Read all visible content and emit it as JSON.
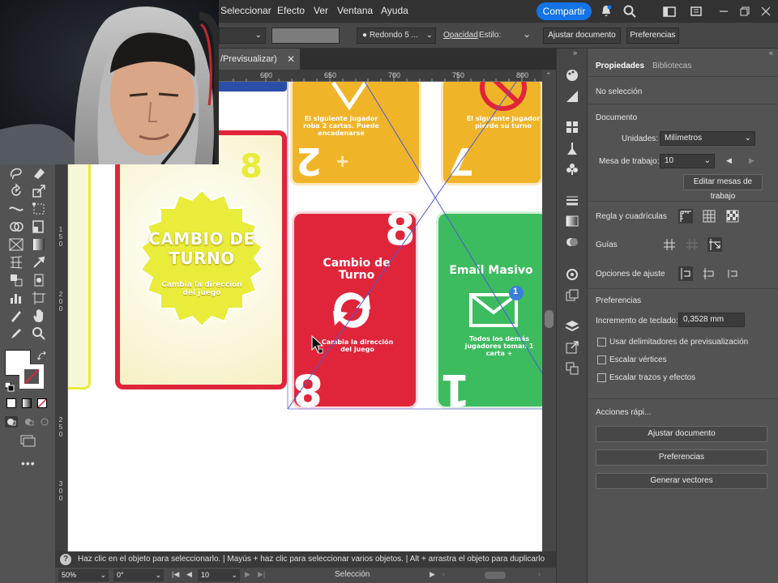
{
  "menubar": {
    "items": [
      "Seleccionar",
      "Efecto",
      "Ver",
      "Ventana",
      "Ayuda"
    ],
    "share_label": "Compartir"
  },
  "controlbar": {
    "brush": "Redondo 5 ...",
    "opacity_label": "Opacidad",
    "style_label": "Estilo:",
    "fit_document": "Ajustar documento",
    "preferences": "Preferencias"
  },
  "document": {
    "tab_label": "/Previsualizar)"
  },
  "ruler": {
    "top_ticks": [
      "600",
      "650",
      "700",
      "750",
      "800"
    ],
    "left_ticks": [
      "1\n5\n0",
      "2\n0\n0",
      "2\n5\n0",
      "3\n0\n0"
    ]
  },
  "canvas": {
    "card_left_title": "CAMBIO DE TURNO",
    "card_left_desc": "Cambia la dirección del juego",
    "card_left_number": "8",
    "card_yellow_desc": "El siguiente jugador roba 2 cartas. Puede encadenarse",
    "card_yellow2_desc": "El siguiente jugador pierde su turno",
    "card_red_title": "Cambio de Turno",
    "card_red_desc": "Cambia la dirección del juego",
    "card_red_number": "8",
    "card_green_title": "Email Masivo",
    "card_green_desc": "Todos los demás jugadores toman 1 carta +",
    "card_green_badge": "1"
  },
  "statusbar": {
    "hint": "Haz clic en el objeto para seleccionarlo.  |  Mayús + haz clic para seleccionar varios objetos.  |  Alt + arrastra el objeto para duplicarlo",
    "zoom": "50%",
    "rotation": "0°",
    "artboard": "10",
    "tool": "Selección"
  },
  "panel": {
    "tab_properties": "Propiedades",
    "tab_libraries": "Bibliotecas",
    "no_selection": "No selección",
    "document_heading": "Documento",
    "units_label": "Unidades:",
    "units_value": "Milímetros",
    "artboard_label": "Mesa de trabajo:",
    "artboard_value": "10",
    "edit_artboards": "Editar mesas de trabajo",
    "ruler_grids": "Regla y cuadrículas",
    "guides": "Guías",
    "snap_options": "Opciones de ajuste",
    "preferences_heading": "Preferencias",
    "keyboard_inc_label": "Incremento de teclado:",
    "keyboard_inc_value": "0,3528 mm",
    "check_preview_bounds": "Usar delimitadores de previsualización",
    "check_scale_corners": "Escalar vértices",
    "check_scale_strokes": "Escalar trazos y efectos",
    "quick_actions": "Acciones rápi...",
    "btn_fit_document": "Ajustar documento",
    "btn_preferences": "Preferencias",
    "btn_generate_vectors": "Generar vectores"
  },
  "colors": {
    "accent": "#1473e6",
    "card_yellow": "#f0b429",
    "card_red": "#e0253b",
    "card_green": "#3dbb5f",
    "card_lime": "#e9ec3a"
  }
}
